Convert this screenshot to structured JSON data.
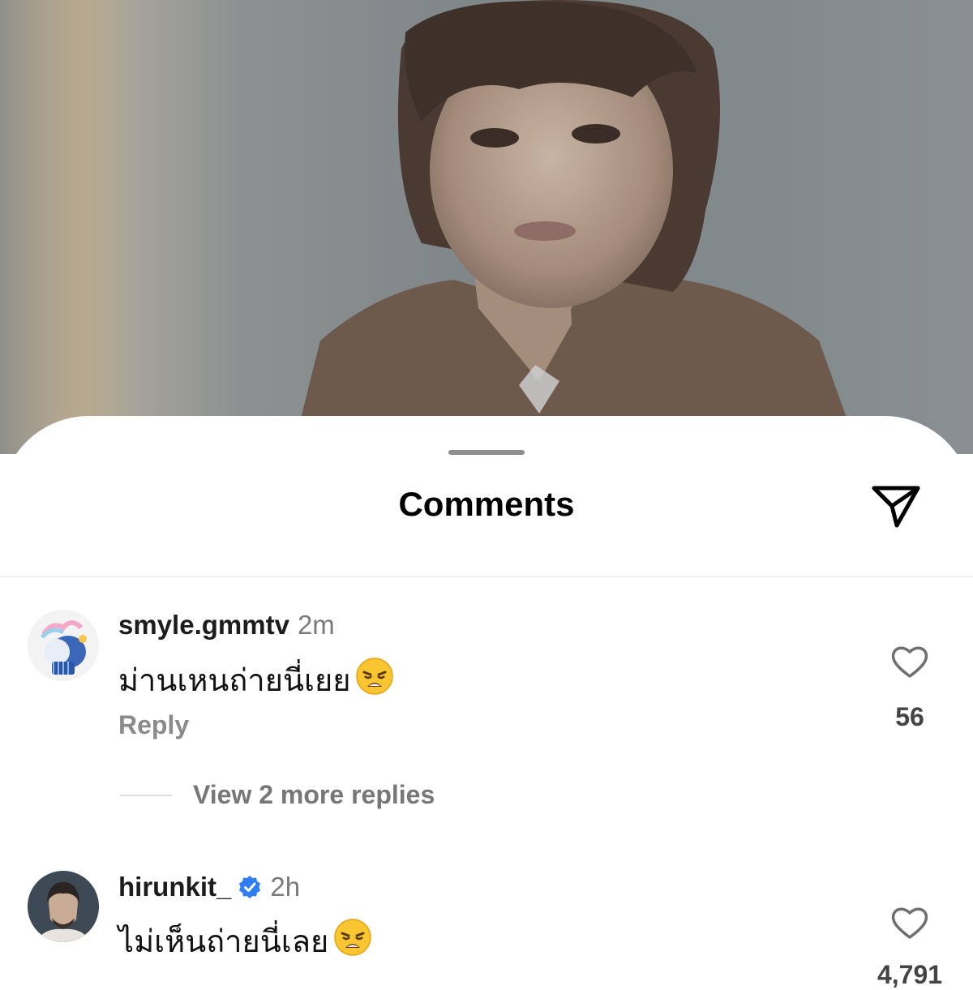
{
  "sheet": {
    "title": "Comments"
  },
  "comments": [
    {
      "username": "smyle.gmmtv",
      "time": "2m",
      "text": "ม่านเหนถ่ายนี่เยย",
      "emoji": "weary-face-emoji",
      "reply_label": "Reply",
      "likes": "56",
      "view_more_label": "View 2 more replies"
    },
    {
      "username": "hirunkit_",
      "verified": true,
      "time": "2h",
      "text": "ไม่เห็นถ่ายนี่เลย",
      "emoji": "weary-face-emoji",
      "likes": "4,791"
    }
  ],
  "colors": {
    "accent_verified": "#2f7df6",
    "heart_stroke": "#6f6f6f"
  }
}
